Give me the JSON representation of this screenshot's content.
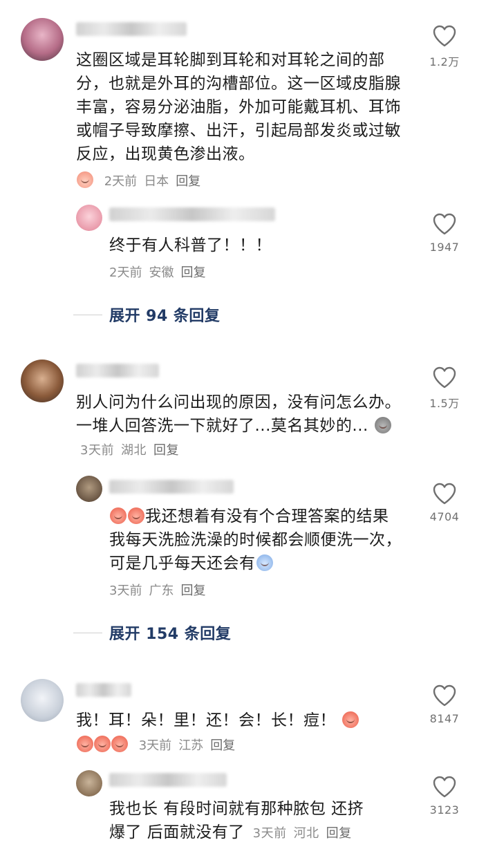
{
  "comments": [
    {
      "text": "这圈区域是耳轮脚到耳轮和对耳轮之间的部分，也就是外耳的沟槽部位。这一区域皮脂腺丰富，容易分泌油脂，外加可能戴耳机、耳饰或帽子导致摩擦、出汗，引起局部发炎或过敏反应，出现黄色渗出液。",
      "time": "2天前",
      "location": "日本",
      "reply_label": "回复",
      "likes": "1.2万",
      "sub_reply": {
        "text": "终于有人科普了！！！",
        "time": "2天前",
        "location": "安徽",
        "reply_label": "回复",
        "likes": "1947"
      },
      "expand_label": "展开 94 条回复"
    },
    {
      "text": "别人问为什么问出现的原因，没有问怎么办。一堆人回答洗一下就好了...莫名其妙的...",
      "time": "3天前",
      "location": "湖北",
      "reply_label": "回复",
      "likes": "1.5万",
      "sub_reply": {
        "text": "我还想着有没有个合理答案的结果 我每天洗脸洗澡的时候都会顺便洗一次，可是几乎每天还会有",
        "time": "3天前",
        "location": "广东",
        "reply_label": "回复",
        "likes": "4704"
      },
      "expand_label": "展开 154 条回复"
    },
    {
      "text": "我！耳！朵！里！还！会！长！痘！",
      "time": "3天前",
      "location": "江苏",
      "reply_label": "回复",
      "likes": "8147",
      "sub_reply": {
        "text_line1": "我也长 有段时间就有那种脓包 还挤",
        "text_line2": "爆了 后面就没有了",
        "time": "3天前",
        "location": "河北",
        "reply_label": "回复",
        "likes": "3123"
      }
    }
  ]
}
